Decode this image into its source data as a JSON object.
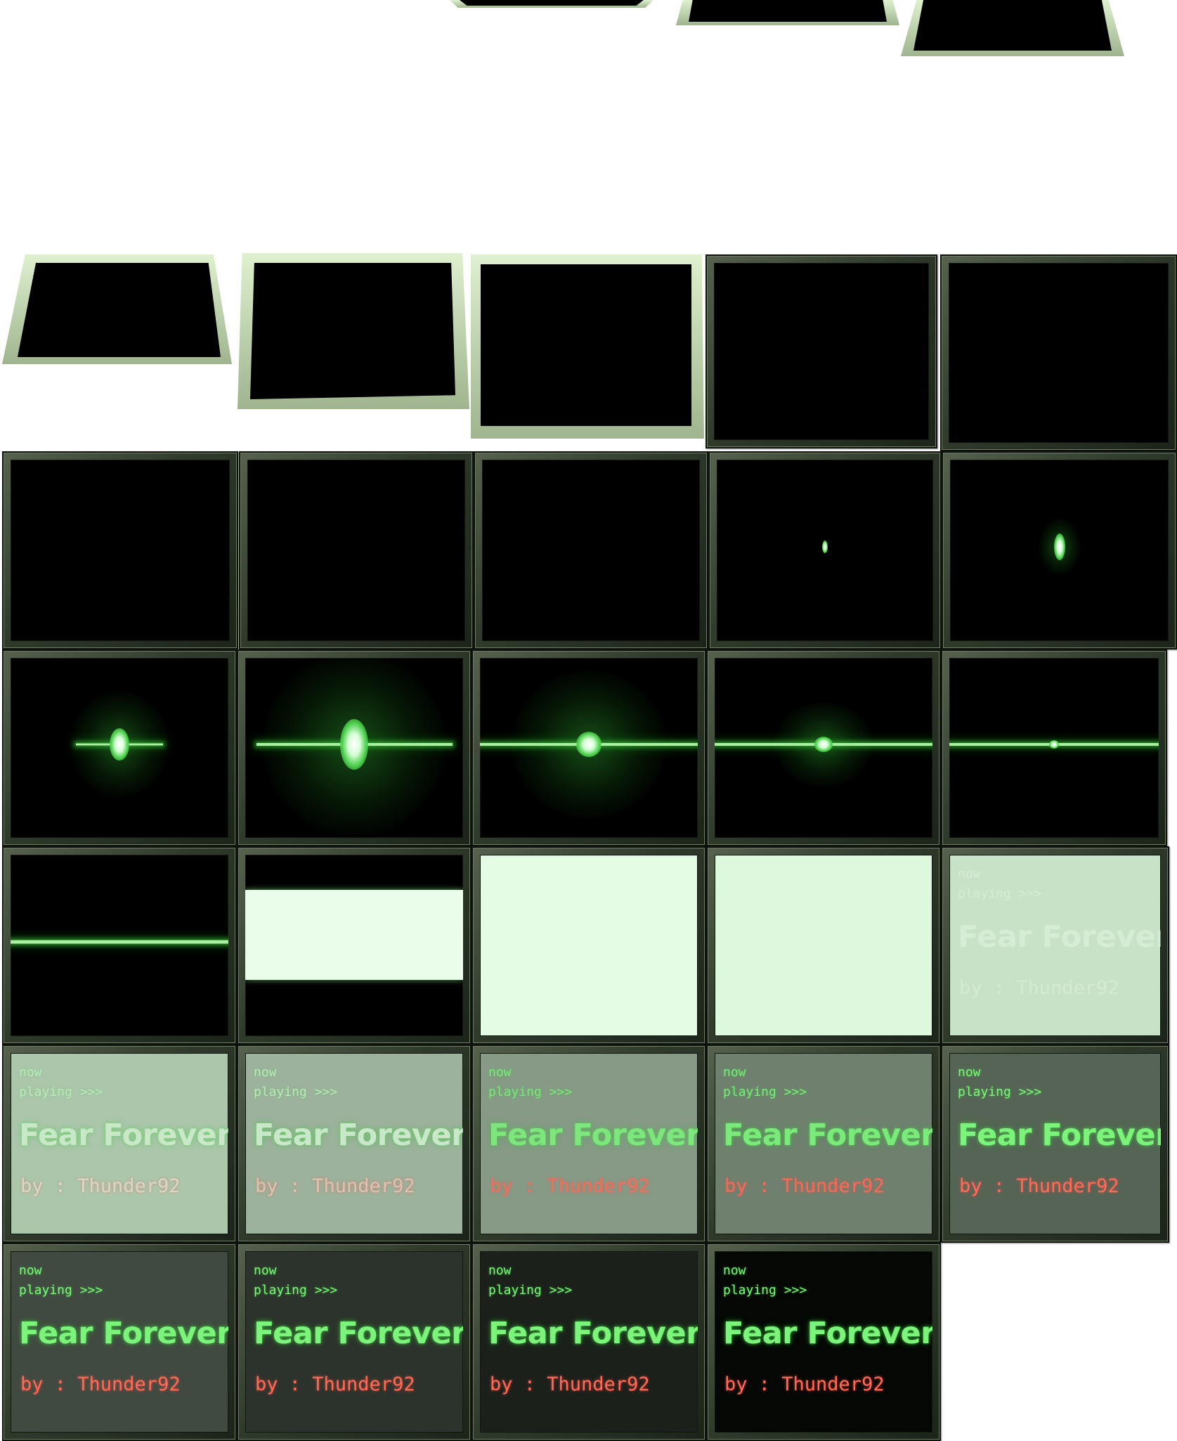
{
  "frames": {
    "now_label": "now",
    "playing_label": "playing >>>",
    "song_title": "Fear Forever",
    "artist_line": "by : Thunder92"
  },
  "colors": {
    "text_green": "#7cf47c",
    "artist_red": "#ff6a5a",
    "frame_light": "#dff0cf",
    "frame_dark": "#2f3a2b",
    "screen_white": "#e6fbe6"
  },
  "text_frame_fade": [
    {
      "screen_color": "#c8e2c8",
      "text_opacity": 0.45
    },
    {
      "screen_color": "#abc6ab",
      "text_opacity": 0.65
    },
    {
      "screen_color": "#9cb29c",
      "text_opacity": 0.75
    },
    {
      "screen_color": "#869a86",
      "text_opacity": 0.85
    },
    {
      "screen_color": "#6f806f",
      "text_opacity": 0.92
    },
    {
      "screen_color": "#566456",
      "text_opacity": 1
    },
    {
      "screen_color": "#414a41",
      "text_opacity": 1
    },
    {
      "screen_color": "#2c332c",
      "text_opacity": 1
    },
    {
      "screen_color": "#1b201b",
      "text_opacity": 1
    },
    {
      "screen_color": "#050705",
      "text_opacity": 1
    }
  ]
}
